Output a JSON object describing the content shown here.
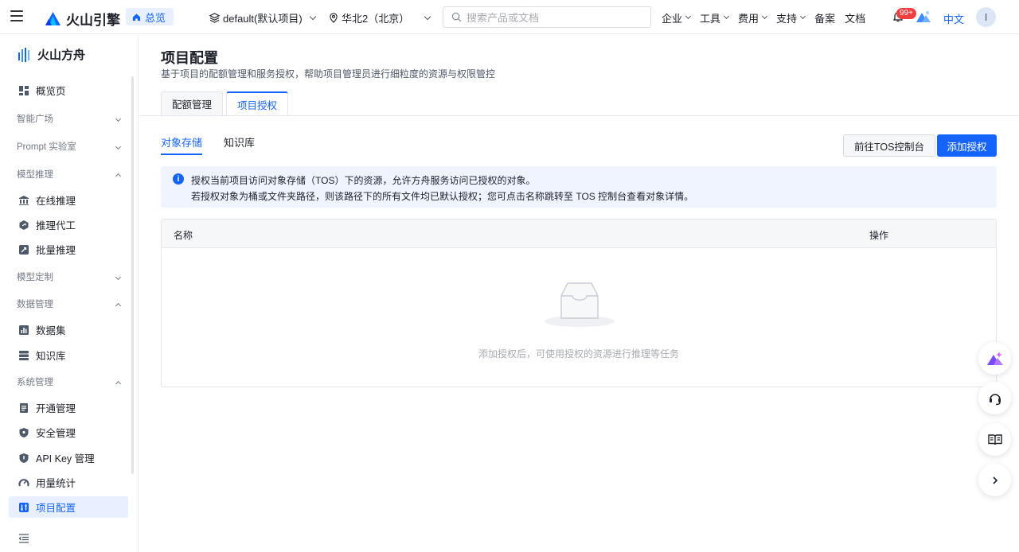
{
  "topbar": {
    "brand": "火山引擎",
    "home_label": "总览",
    "project_label": "default(默认项目)",
    "region_label": "华北2（北京）",
    "search_placeholder": "搜索产品或文档",
    "nav": [
      "企业",
      "工具",
      "费用",
      "支持"
    ],
    "link_beian": "备案",
    "link_docs": "文档",
    "badge": "99+",
    "lang": "中文",
    "avatar": "I"
  },
  "sidebar": {
    "brand": "火山方舟",
    "overview": "概览页",
    "groups": {
      "plaza": "智能广场",
      "prompt": "Prompt 实验室",
      "inference": "模型推理",
      "custom": "模型定制",
      "data": "数据管理",
      "system": "系统管理"
    },
    "items": {
      "online": "在线推理",
      "agent": "推理代工",
      "batch": "批量推理",
      "dataset": "数据集",
      "kb": "知识库",
      "activation": "开通管理",
      "security": "安全管理",
      "apikey": "API Key 管理",
      "usage": "用量统计",
      "project": "项目配置"
    }
  },
  "main": {
    "title": "项目配置",
    "subtitle": "基于项目的配额管理和服务授权，帮助项目管理员进行细粒度的资源与权限管控",
    "tabs": [
      "配额管理",
      "项目授权"
    ],
    "subtabs": [
      "对象存储",
      "知识库"
    ],
    "btn_tos": "前往TOS控制台",
    "btn_add": "添加授权",
    "alert_line1": "授权当前项目访问对象存储（TOS）下的资源，允许方舟服务访问已授权的对象。",
    "alert_line2": "若授权对象为桶或文件夹路径，则该路径下的所有文件均已默认授权；您可点击名称跳转至 TOS 控制台查看对象详情。",
    "col_name": "名称",
    "col_op": "操作",
    "empty_text": "添加授权后，可使用授权的资源进行推理等任务"
  },
  "colors": {
    "accent": "#1664ff",
    "active_bg": "#e8f0ff",
    "alert_bg": "#f0f4ff"
  }
}
